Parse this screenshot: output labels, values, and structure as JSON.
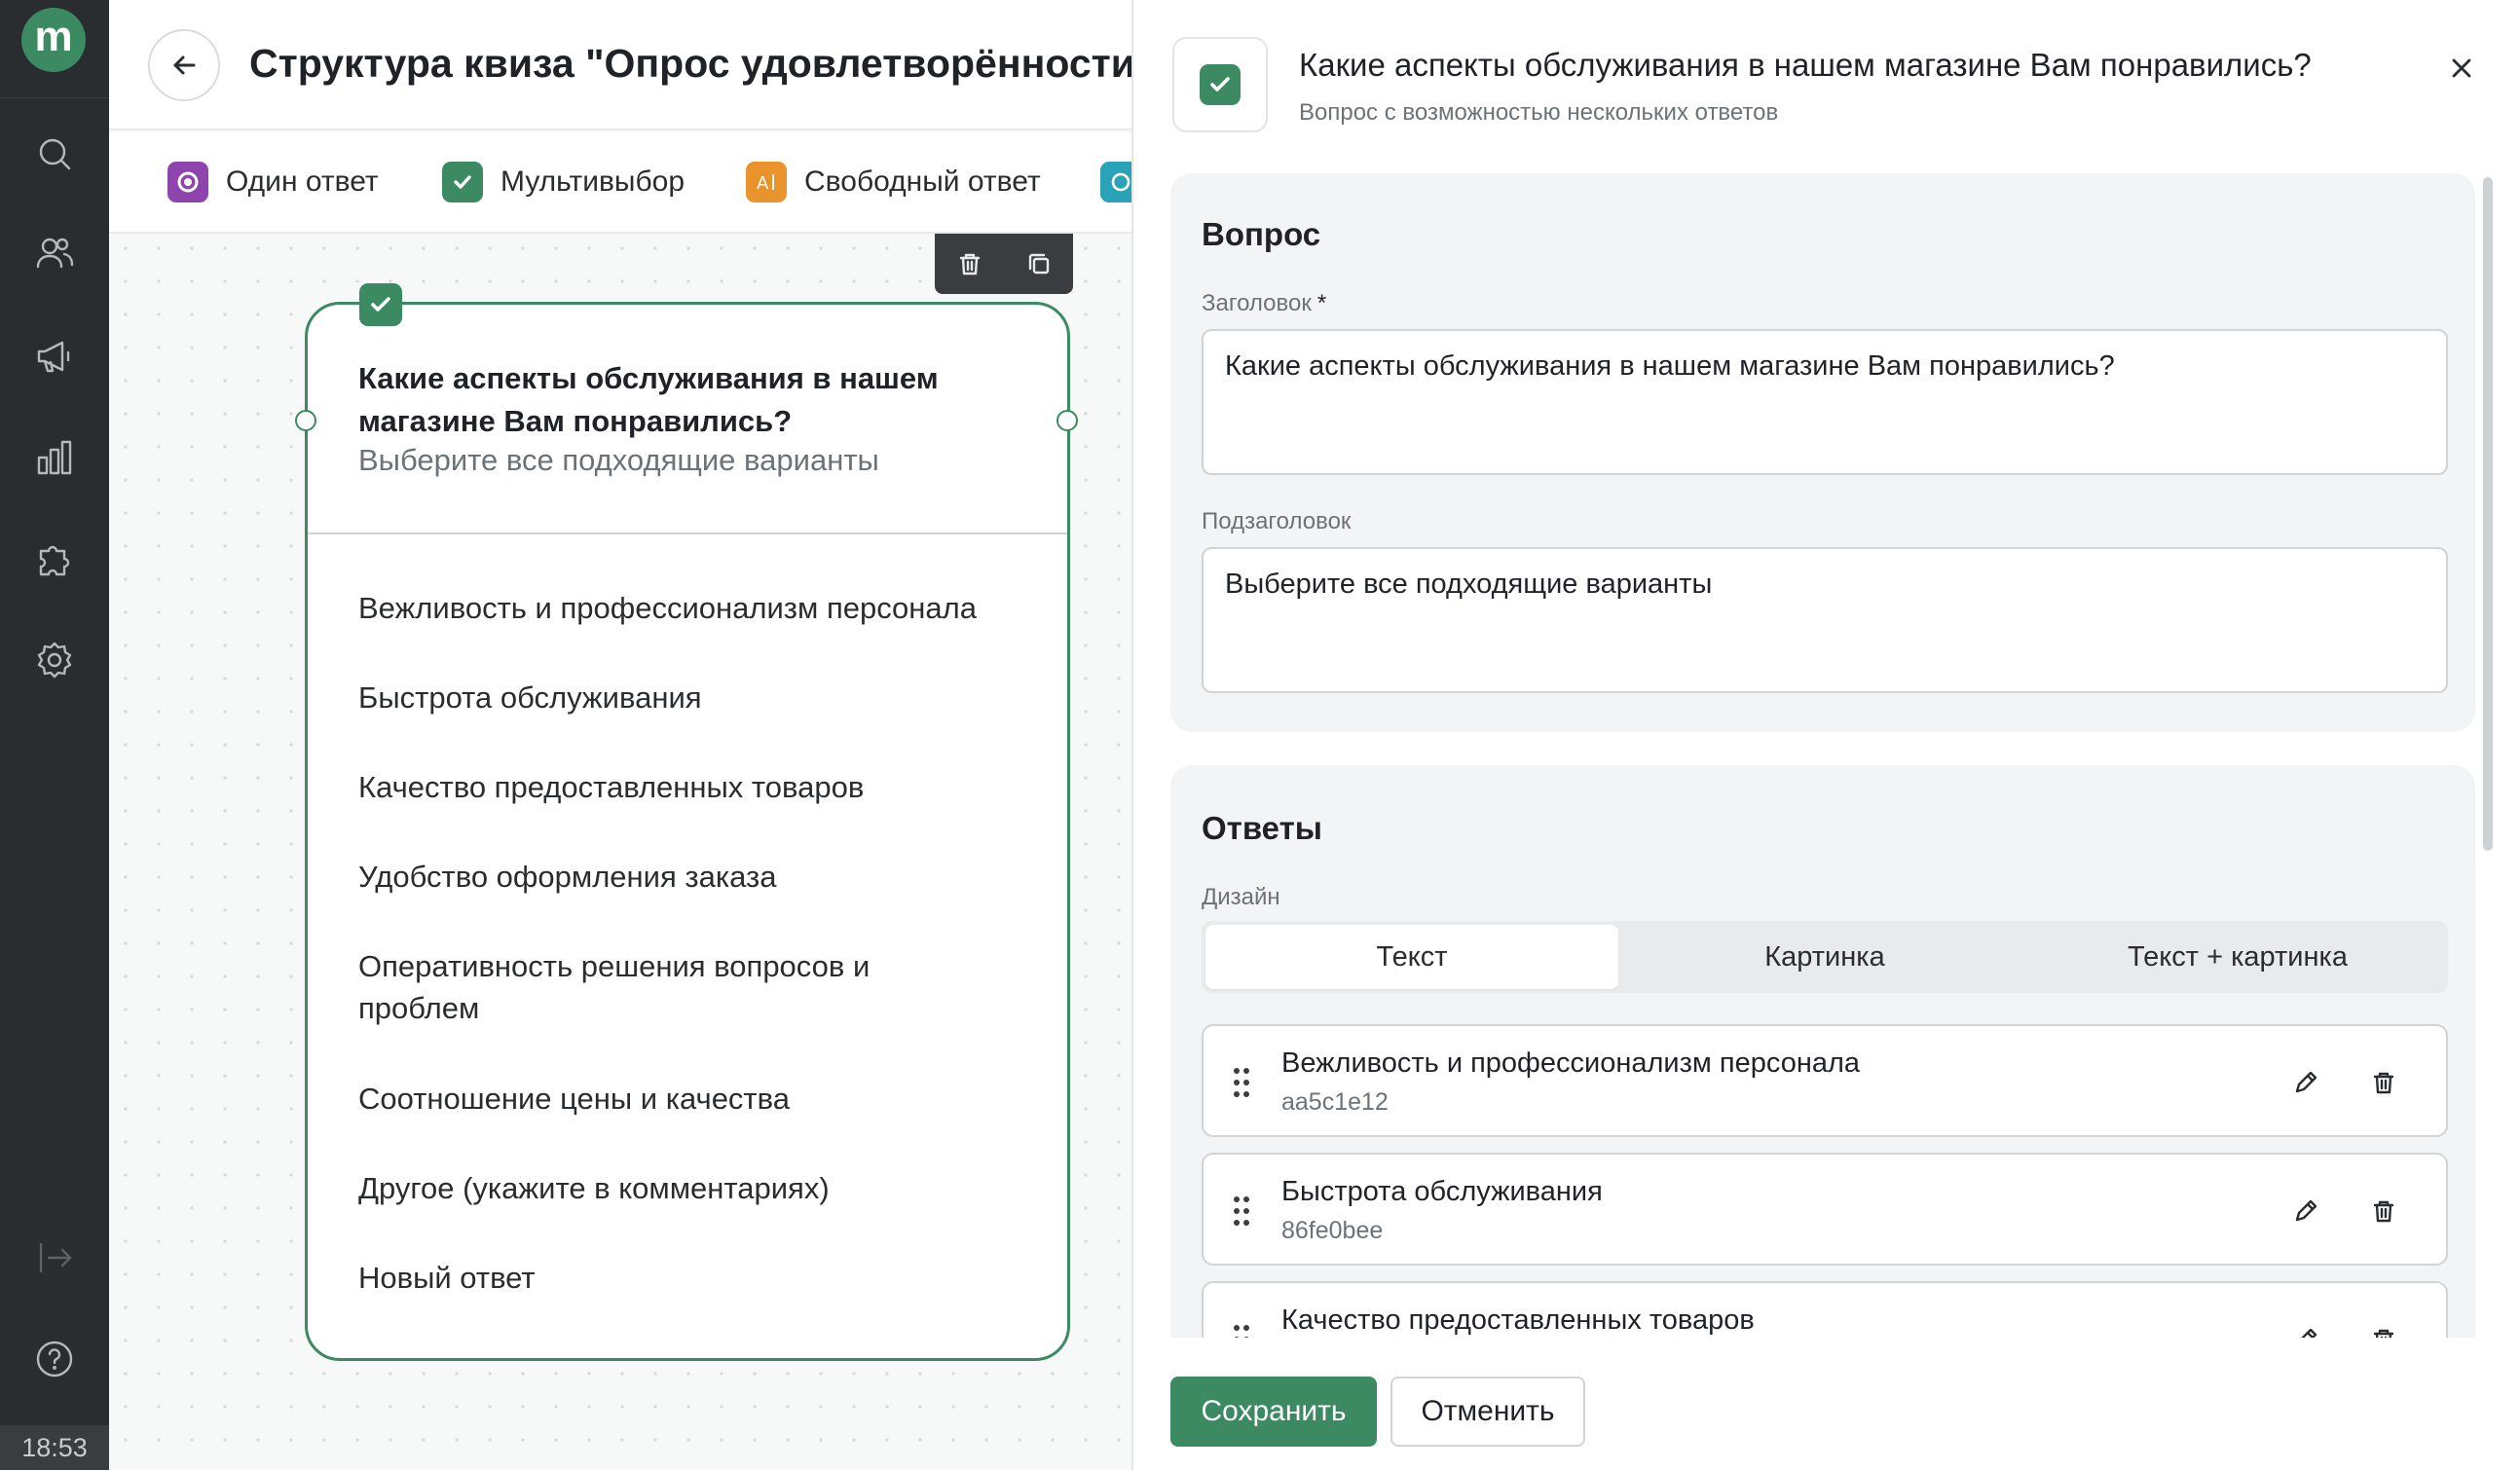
{
  "sidebar": {
    "logo_letter": "m",
    "icons": [
      "search-icon",
      "users-icon",
      "megaphone-icon",
      "chart-icon",
      "puzzle-icon",
      "gear-icon",
      "logout-icon",
      "help-icon"
    ],
    "clock": "18:53"
  },
  "header": {
    "title": "Структура квиза \"Опрос удовлетворённости клиентов\""
  },
  "question_types": [
    {
      "label": "Один ответ",
      "color": "#8e44ad"
    },
    {
      "label": "Мультивыбор",
      "color": "#3b8a61"
    },
    {
      "label": "Свободный ответ",
      "color": "#e8932c"
    }
  ],
  "node": {
    "title": "Какие аспекты обслуживания в нашем магазине Вам понравились?",
    "subtitle": "Выберите все подходящие варианты",
    "answers": [
      "Вежливость и профессионализм персонала",
      "Быстрота обслуживания",
      "Качество предоставленных товаров",
      "Удобство оформления заказа",
      "Оперативность решения вопросов и проблем",
      "Соотношение цены и качества",
      "Другое (укажите в комментариях)",
      "Новый ответ"
    ]
  },
  "panel": {
    "title": "Какие аспекты обслуживания в нашем магазине Вам понравились?",
    "subtitle": "Вопрос с возможностью нескольких ответов",
    "question_section": {
      "title": "Вопрос",
      "heading_label": "Заголовок",
      "required_mark": "*",
      "heading_value": "Какие аспекты обслуживания в нашем магазине Вам понравились?",
      "subheading_label": "Подзаголовок",
      "subheading_value": "Выберите все подходящие варианты"
    },
    "answers_section": {
      "title": "Ответы",
      "design_label": "Дизайн",
      "design_options": [
        "Текст",
        "Картинка",
        "Текст + картинка"
      ],
      "design_selected": "Текст",
      "items": [
        {
          "label": "Вежливость и профессионализм персонала",
          "id": "aa5c1e12"
        },
        {
          "label": "Быстрота обслуживания",
          "id": "86fe0bee"
        },
        {
          "label": "Качество предоставленных товаров",
          "id": ""
        }
      ]
    },
    "save_label": "Сохранить",
    "cancel_label": "Отменить"
  },
  "colors": {
    "accent": "#3b8a61",
    "rail": "#2a2d2f"
  }
}
